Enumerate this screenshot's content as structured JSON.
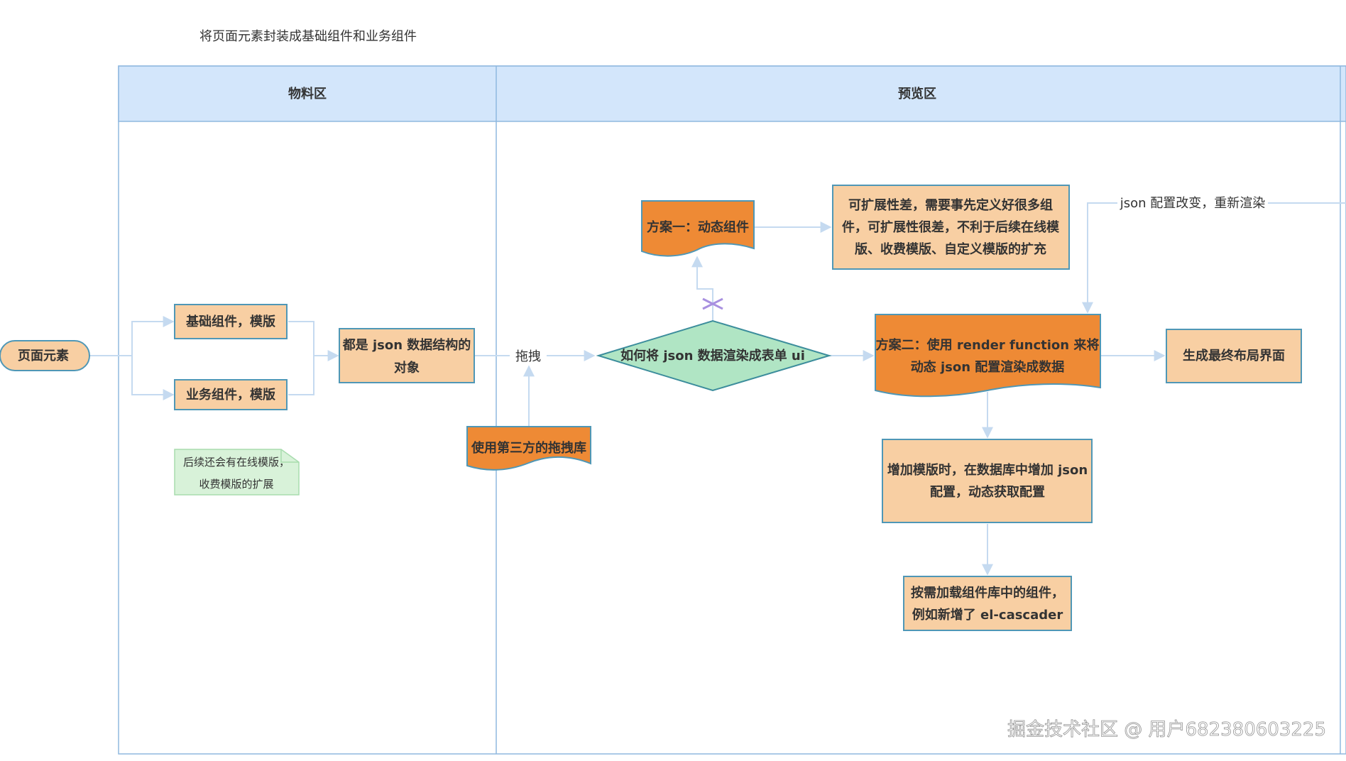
{
  "caption": "将页面元素封装成基础组件和业务组件",
  "lanes": {
    "material": "物料区",
    "preview": "预览区"
  },
  "nodes": {
    "page_element": "页面元素",
    "basic_component": "基础组件，模版",
    "business_component": "业务组件，模版",
    "json_object_line1": "都是 json 数据结构的",
    "json_object_line2": "对象",
    "note_line1": "后续还会有在线模版，",
    "note_line2": "收费模版的扩展",
    "third_party_drag": "使用第三方的拖拽库",
    "decision": "如何将 json 数据渲染成表单 ui",
    "plan_one": "方案一：动态组件",
    "plan_one_drawback_line1": "可扩展性差，需要事先定义好很多组",
    "plan_one_drawback_line2": "件，可扩展性很差，不利于后续在线模",
    "plan_one_drawback_line3": "版、收费模版、自定义模版的扩充",
    "plan_two_line1": "方案二：使用 render function 来将",
    "plan_two_line2": "动态 json 配置渲染成数据",
    "final_layout": "生成最终布局界面",
    "add_template_line1": "增加模版时，在数据库中增加 json",
    "add_template_line2": "配置，动态获取配置",
    "load_on_demand_line1": "按需加载组件库中的组件，",
    "load_on_demand_line2": "例如新增了 el-cascader"
  },
  "edges": {
    "drag": "拖拽",
    "json_change": "json 配置改变，重新渲染"
  },
  "watermark": "掘金技术社区 @ 用户682380603225",
  "colors": {
    "lane_header": "#d3e6fb",
    "lane_border": "#8fb8df",
    "box_fill": "#f8cfa3",
    "box_border": "#4f97b6",
    "orange_fill": "#ee8a35",
    "decision_fill": "#b0e5c4",
    "decision_border": "#3c8d9c",
    "note_fill": "#d8f2d9",
    "note_border": "#a8dcae",
    "arrow": "#c5daf0"
  }
}
